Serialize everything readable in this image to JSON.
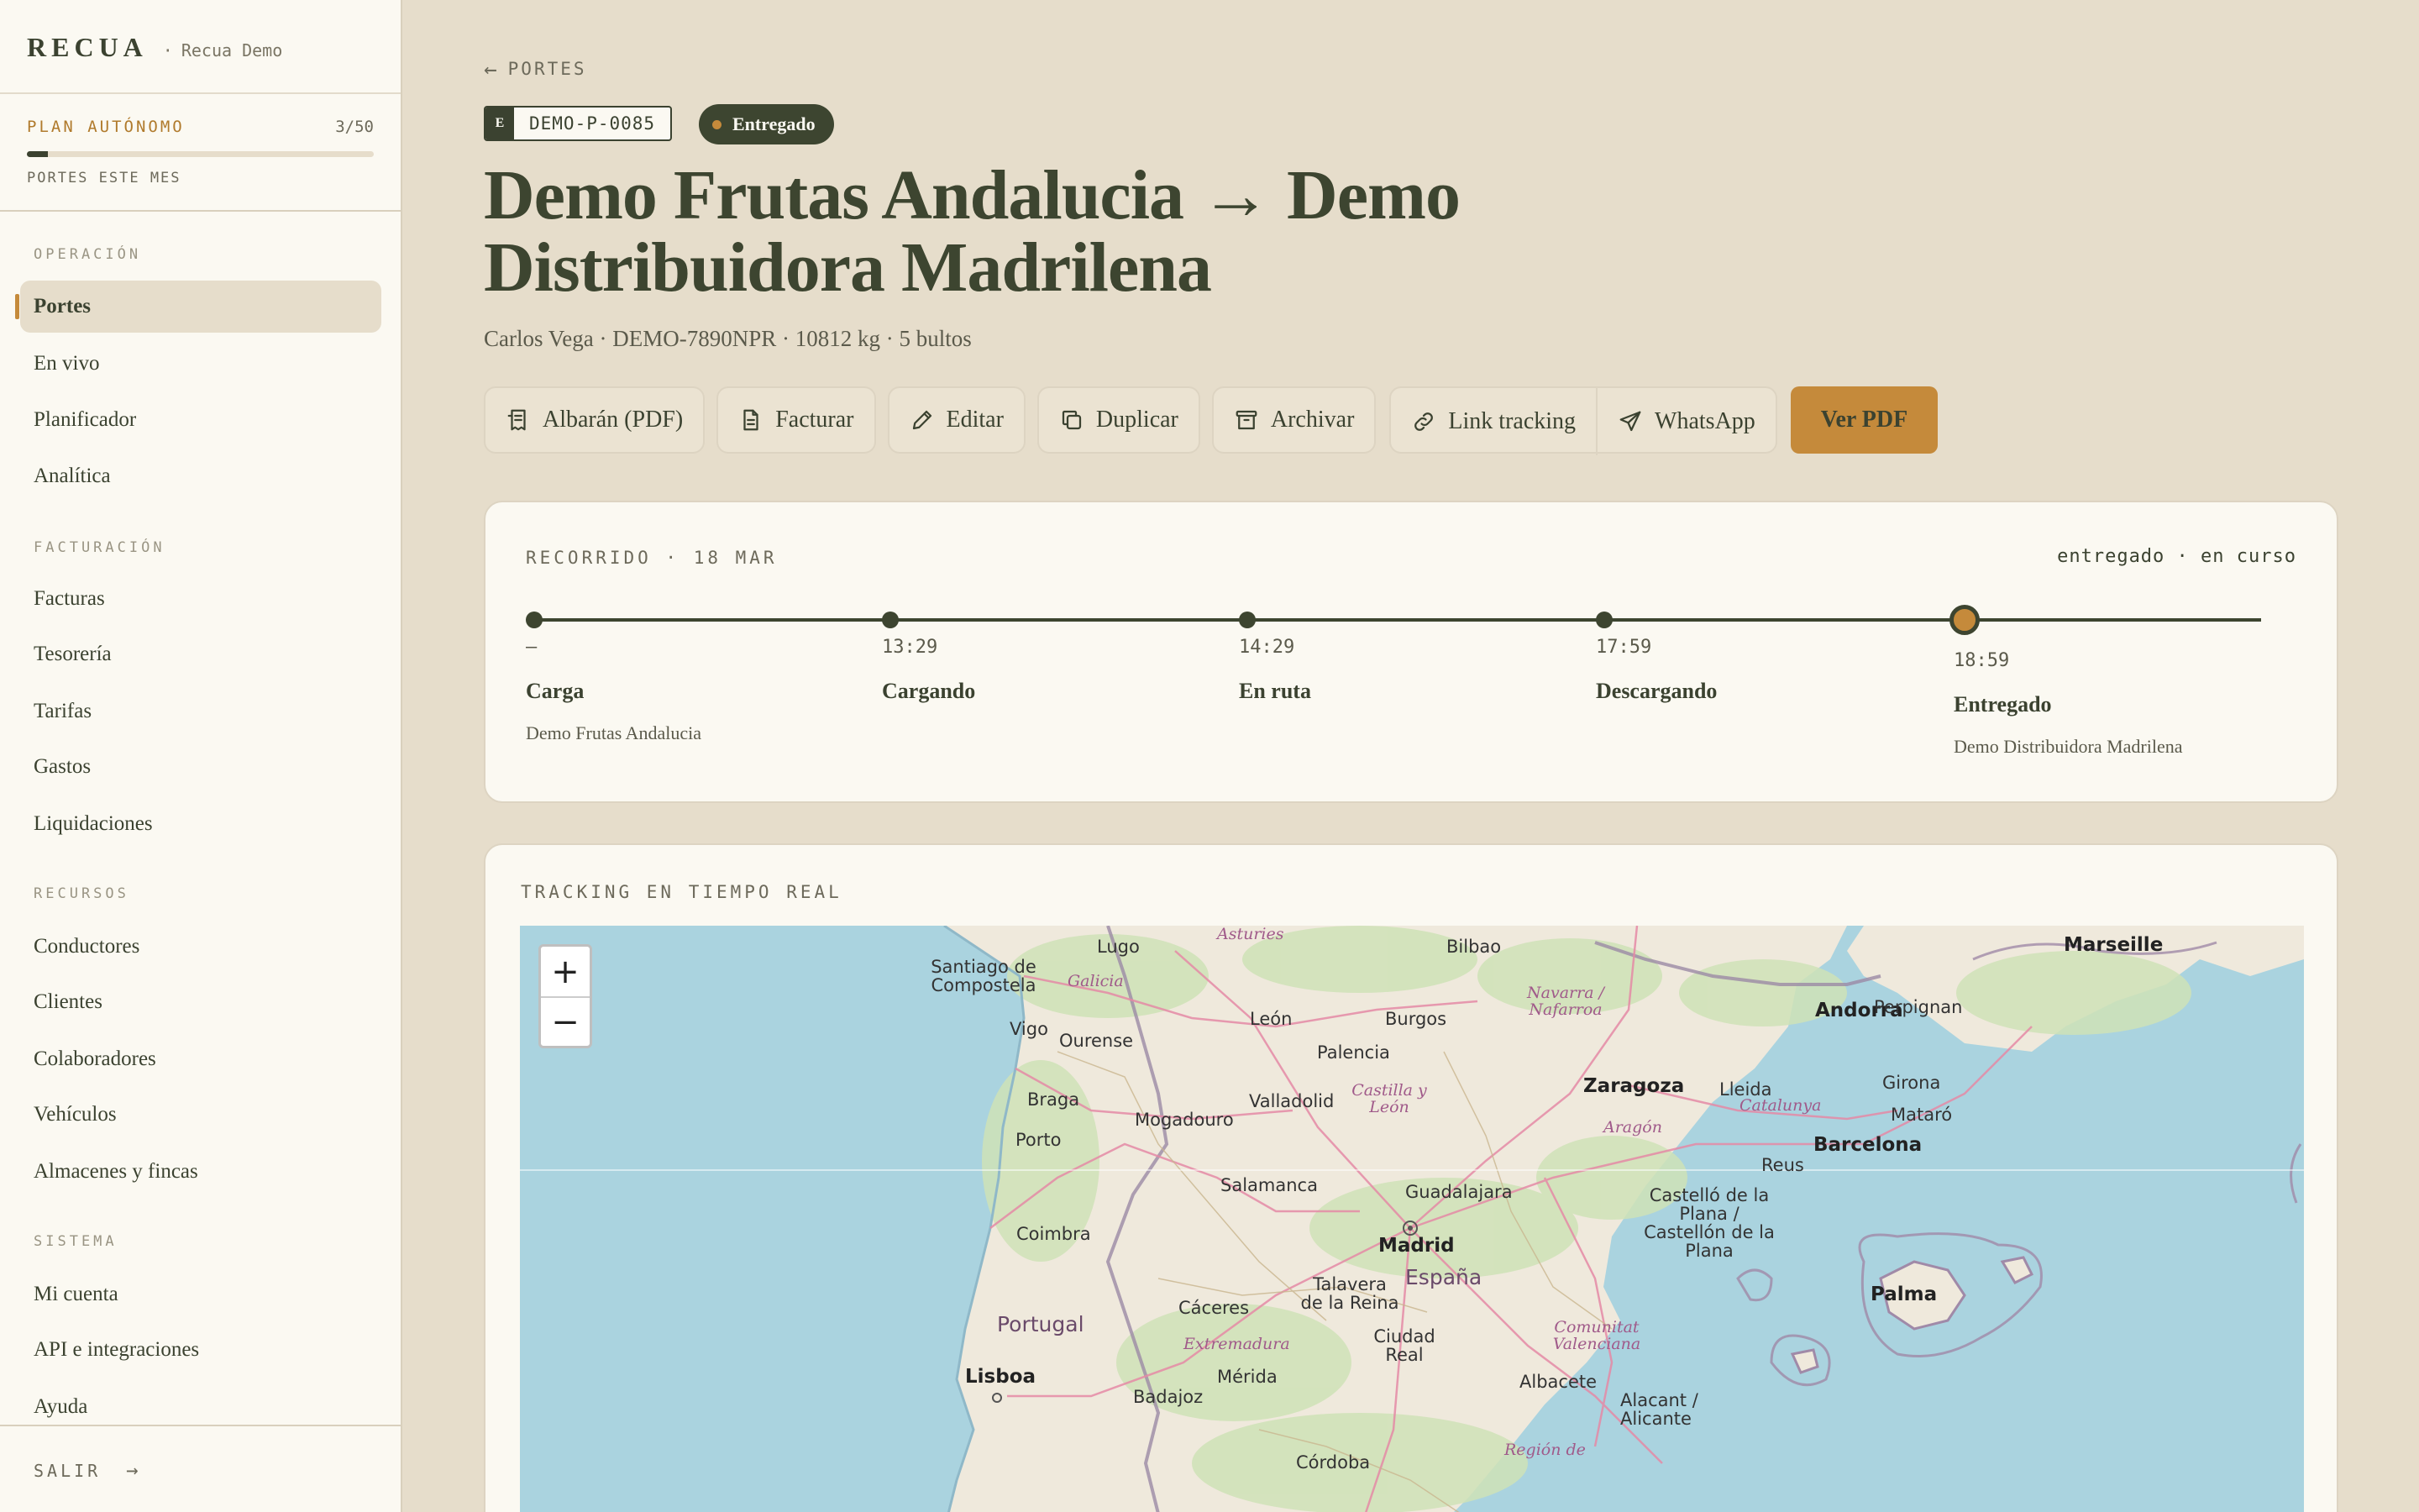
{
  "sidebar": {
    "brand": "RECUA",
    "separator": "·",
    "workspace": "Recua Demo",
    "plan": {
      "name": "PLAN AUTÓNOMO",
      "count": "3/50",
      "progress": 0.06,
      "label": "PORTES ESTE MES"
    },
    "sections": [
      {
        "title": "OPERACIÓN",
        "items": [
          "Portes",
          "En vivo",
          "Planificador",
          "Analítica"
        ]
      },
      {
        "title": "FACTURACIÓN",
        "items": [
          "Facturas",
          "Tesorería",
          "Tarifas",
          "Gastos",
          "Liquidaciones"
        ]
      },
      {
        "title": "RECURSOS",
        "items": [
          "Conductores",
          "Clientes",
          "Colaboradores",
          "Vehículos",
          "Almacenes y fincas"
        ]
      },
      {
        "title": "SISTEMA",
        "items": [
          "Mi cuenta",
          "API e integraciones",
          "Ayuda"
        ]
      }
    ],
    "active_item": "Portes",
    "logout": "SALIR",
    "logout_arrow": "→"
  },
  "header": {
    "back_arrow": "←",
    "back_label": "PORTES",
    "ref_letter": "E",
    "ref_code": "DEMO-P-0085",
    "status": "Entregado",
    "title": "Demo Frutas Andalucia → Demo Distribuidora Madrilena",
    "meta": "Carlos Vega · DEMO-7890NPR · 10812 kg · 5 bultos"
  },
  "actions": {
    "albaran": "Albarán (PDF)",
    "facturar": "Facturar",
    "editar": "Editar",
    "duplicar": "Duplicar",
    "archivar": "Archivar",
    "link_tracking": "Link tracking",
    "whatsapp": "WhatsApp",
    "ver_pdf": "Ver PDF"
  },
  "route": {
    "label": "RECORRIDO · 18 MAR",
    "status_text": "entregado · en curso",
    "steps": [
      {
        "time": "—",
        "name": "Carga",
        "place": "Demo Frutas Andalucia"
      },
      {
        "time": "13:29",
        "name": "Cargando",
        "place": ""
      },
      {
        "time": "14:29",
        "name": "En ruta",
        "place": ""
      },
      {
        "time": "17:59",
        "name": "Descargando",
        "place": ""
      },
      {
        "time": "18:59",
        "name": "Entregado",
        "place": "Demo Distribuidora Madrilena"
      }
    ],
    "current_step": 4
  },
  "map": {
    "label": "TRACKING EN TIEMPO REAL",
    "zoom_in": "+",
    "zoom_out": "−",
    "cities": [
      "Lugo",
      "Santiago de Compostela",
      "Vigo",
      "Ourense",
      "León",
      "Burgos",
      "Bilbao",
      "Palencia",
      "Valladolid",
      "Braga",
      "Porto",
      "Mogadouro",
      "Salamanca",
      "Guadalajara",
      "Madrid",
      "Coimbra",
      "Talavera de la Reina",
      "Cáceres",
      "Ciudad Real",
      "Mérida",
      "Badajoz",
      "Lisboa",
      "Albacete",
      "Alacant / Alicante",
      "Zaragoza",
      "Lleida",
      "Barcelona",
      "Girona",
      "Mataró",
      "Reus",
      "Castelló de la Plana / Castellón de la Plana",
      "Palma",
      "Andorra",
      "Perpignan",
      "Marseille",
      "Córdoba"
    ],
    "regions": [
      "Asturies",
      "Galicia",
      "Navarra / Nafarroa",
      "Castilla y León",
      "Aragón",
      "Catalunya",
      "Extremadura",
      "Comunitat Valenciana",
      "Región de"
    ],
    "countries": [
      "Portugal",
      "España"
    ]
  },
  "colors": {
    "accent": "#c58a3b",
    "primary_dark": "#3d4530",
    "background": "#e6ddcb",
    "card": "#fbf9f2",
    "water": "#aad3df",
    "land": "#efe9dc"
  }
}
